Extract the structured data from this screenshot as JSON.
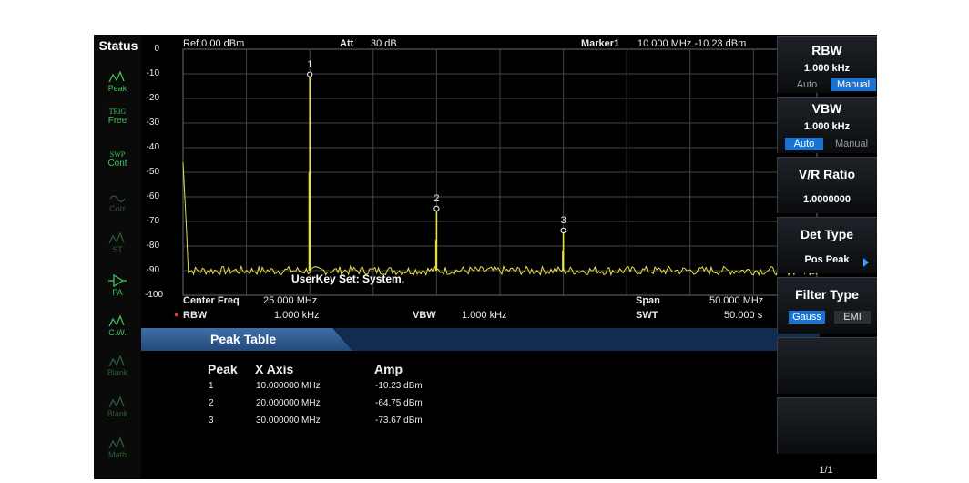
{
  "status": {
    "title": "Status",
    "items": [
      {
        "label": "Peak",
        "icon": "peak-detector-icon",
        "active": true
      },
      {
        "label": "TRIG Free",
        "line1": "TRIG",
        "line2": "Free",
        "icon": "trigger-icon",
        "active": true
      },
      {
        "label": "SWP Cont",
        "line1": "SWP",
        "line2": "Cont",
        "icon": "sweep-icon",
        "active": true
      },
      {
        "label": "Corr",
        "icon": "correction-icon",
        "active": false
      },
      {
        "label": "ST",
        "icon": "sweep-time-icon",
        "active": false
      },
      {
        "label": "PA",
        "icon": "preamp-icon",
        "active": true
      },
      {
        "label": "C.W.",
        "icon": "trace-clear-write-icon",
        "active": true
      },
      {
        "label": "Blank",
        "icon": "trace-blank-icon",
        "active": false
      },
      {
        "label": "Blank",
        "icon": "trace-blank-icon",
        "active": false
      },
      {
        "label": "Math",
        "icon": "trace-math-icon",
        "active": false
      }
    ]
  },
  "header": {
    "ref": "Ref  0.00 dBm",
    "att_label": "Att",
    "att_value": "30 dB",
    "marker_label": "Marker1",
    "marker_value": "10.000 MHz  -10.23 dBm"
  },
  "y_labels": [
    "0",
    "-10",
    "-20",
    "-30",
    "-40",
    "-50",
    "-60",
    "-70",
    "-80",
    "-90",
    "-100"
  ],
  "user_key": "UserKey Set:  System,",
  "footer": {
    "center_label": "Center Freq",
    "center_value": "25.000 MHz",
    "span_label": "Span",
    "span_value": "50.000 MHz",
    "rbw_label": "RBW",
    "rbw_value": "1.000 kHz",
    "vbw_label": "VBW",
    "vbw_value": "1.000 kHz",
    "swt_label": "SWT",
    "swt_value": "50.000 s"
  },
  "chart_data": {
    "type": "line",
    "x_unit": "MHz",
    "y_unit": "dBm",
    "xlim": [
      0,
      50
    ],
    "ylim": [
      -100,
      0
    ],
    "grid": true,
    "noise_floor": -90,
    "trace_color": "#e8e04a",
    "markers": [
      {
        "label": "1",
        "x": 10.0,
        "y": -10.23
      },
      {
        "label": "2",
        "x": 20.0,
        "y": -64.75
      },
      {
        "label": "3",
        "x": 30.0,
        "y": -73.67
      }
    ]
  },
  "peak_table": {
    "title": "Peak Table",
    "headers": [
      "Peak",
      "X Axis",
      "Amp"
    ],
    "rows": [
      {
        "peak": "1",
        "x": "10.000000 MHz",
        "amp": "-10.23 dBm"
      },
      {
        "peak": "2",
        "x": "20.000000 MHz",
        "amp": "-64.75 dBm"
      },
      {
        "peak": "3",
        "x": "30.000000 MHz",
        "amp": "-73.67 dBm"
      }
    ]
  },
  "softkeys": {
    "rbw": {
      "title": "RBW",
      "value": "1.000 kHz",
      "opt_auto": "Auto",
      "opt_manual": "Manual",
      "selected": "Manual"
    },
    "vbw": {
      "title": "VBW",
      "value": "1.000 kHz",
      "opt_auto": "Auto",
      "opt_manual": "Manual",
      "selected": "Auto"
    },
    "vr_ratio": {
      "title": "V/R Ratio",
      "value": "1.0000000"
    },
    "det_type": {
      "title": "Det Type",
      "value": "Pos Peak"
    },
    "filter_type": {
      "title": "Filter Type",
      "opt_gauss": "Gauss",
      "opt_emi": "EMI",
      "selected": "Gauss"
    },
    "page": "1/1"
  },
  "colors": {
    "accent_blue": "#1b73d1",
    "status_green": "#3fc35a",
    "trace_yellow": "#e8e04a"
  }
}
